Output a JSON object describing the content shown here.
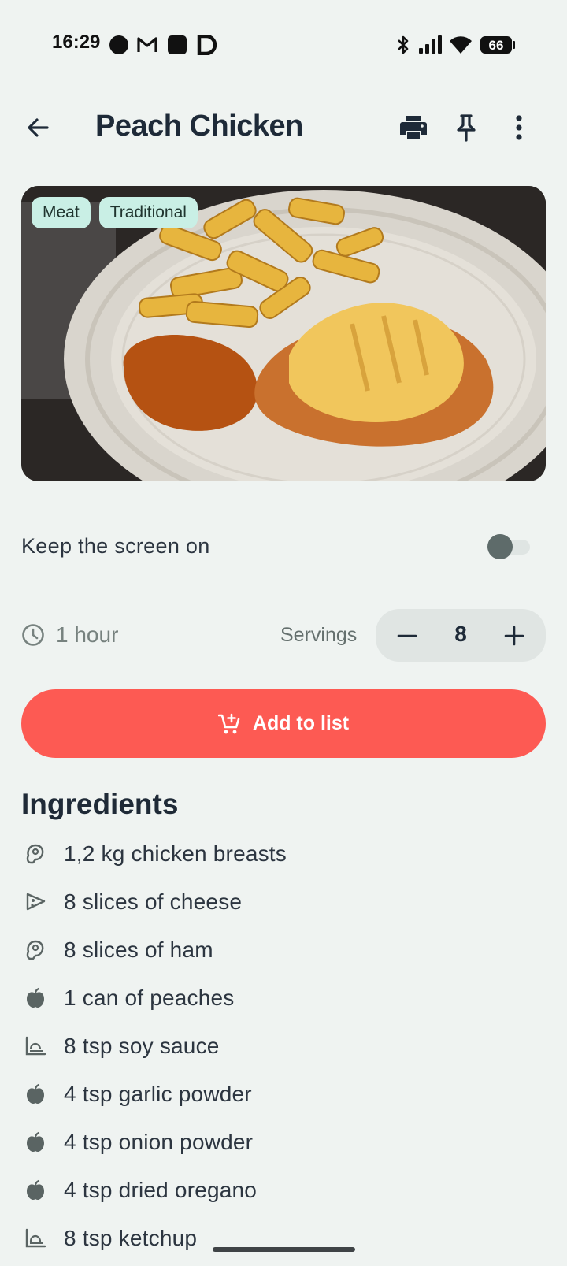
{
  "status_bar": {
    "time": "16:29",
    "battery": "66",
    "notification_icons": [
      "record-dot-icon",
      "gmail-icon",
      "app-square-icon",
      "d-app-icon"
    ],
    "system_icons": [
      "bluetooth-icon",
      "cellular-signal-icon",
      "wifi-icon",
      "battery-icon"
    ]
  },
  "app_bar": {
    "title": "Peach Chicken",
    "actions": [
      "print-icon",
      "pin-icon",
      "more-vert-icon"
    ]
  },
  "hero": {
    "tags": [
      "Meat",
      "Traditional"
    ]
  },
  "keep_screen": {
    "label": "Keep the screen on",
    "enabled": false
  },
  "recipe_meta": {
    "time": "1 hour",
    "servings_label": "Servings",
    "servings_value": "8",
    "decrement": "−",
    "increment": "+"
  },
  "actions": {
    "add_to_list": "Add to list"
  },
  "ingredients": {
    "title": "Ingredients",
    "items": [
      {
        "text": "1,2 kg chicken breasts",
        "icon": "meat-icon"
      },
      {
        "text": "8 slices of cheese",
        "icon": "cheese-icon"
      },
      {
        "text": "8 slices of ham",
        "icon": "meat-icon"
      },
      {
        "text": "1 can of peaches",
        "icon": "produce-icon"
      },
      {
        "text": "8 tsp soy sauce",
        "icon": "condiment-icon"
      },
      {
        "text": "4 tsp garlic powder",
        "icon": "produce-icon"
      },
      {
        "text": "4 tsp onion powder",
        "icon": "produce-icon"
      },
      {
        "text": "4 tsp dried oregano",
        "icon": "produce-icon"
      },
      {
        "text": "8 tsp ketchup",
        "icon": "condiment-icon"
      }
    ]
  },
  "colors": {
    "background": "#eff3f1",
    "accent": "#fd5a53",
    "tag_background": "#c9efe5",
    "title_text": "#1e2a38"
  }
}
